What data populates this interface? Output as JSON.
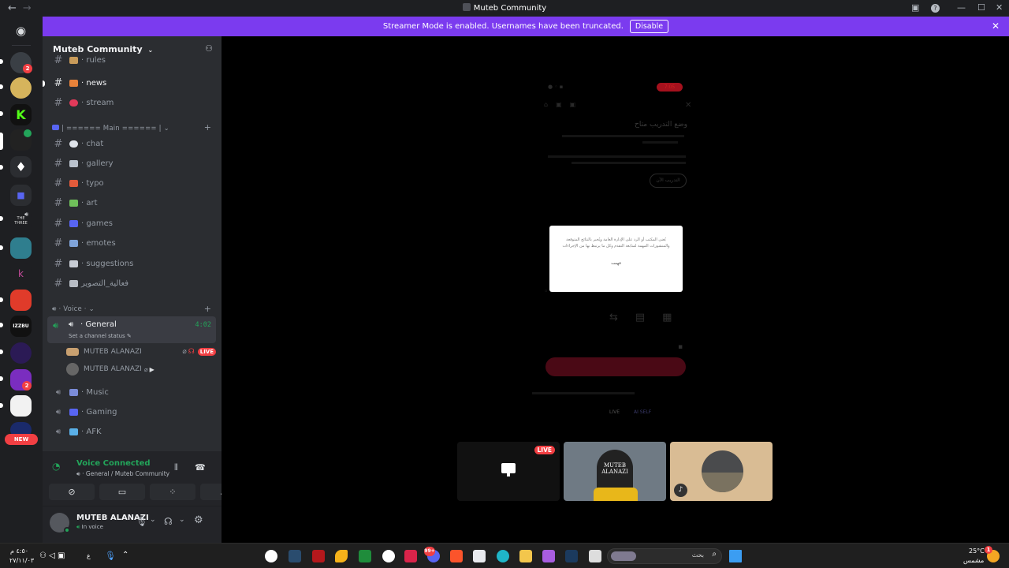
{
  "window": {
    "title": "Muteb Community",
    "back": "←",
    "forward": "→",
    "minimize": "—",
    "maximize": "☐",
    "close": "✕",
    "help": "?"
  },
  "banner": {
    "text": "Streamer Mode is enabled. Usernames have been truncated.",
    "button": "Disable"
  },
  "server_badges": {
    "first": "2",
    "second": "2",
    "new_label": "NEW",
    "vertical_label": "THE\nTHREE"
  },
  "guild": {
    "name": "Muteb Community"
  },
  "channels_top": [
    {
      "name": "rules",
      "emoji_color": "#c89b5a"
    },
    {
      "name": "news",
      "emoji_color": "#e8823a",
      "active": true
    },
    {
      "name": "stream",
      "emoji_color": "#e23a5a"
    }
  ],
  "category_main": {
    "label": "| ====== Main ====== |"
  },
  "channels_main": [
    {
      "name": "chat",
      "emoji_color": "#dfe3ea"
    },
    {
      "name": "gallery",
      "emoji_color": "#b9c1cc"
    },
    {
      "name": "typo",
      "emoji_color": "#e25b3b"
    },
    {
      "name": "art",
      "emoji_color": "#6fbf5a"
    },
    {
      "name": "games",
      "emoji_color": "#5865f2"
    },
    {
      "name": "emotes",
      "emoji_color": "#7fa3d8"
    },
    {
      "name": "suggestions",
      "emoji_color": "#c7ccd4"
    },
    {
      "name": "فعالية_التصوير",
      "emoji_color": "#b7bcc4"
    }
  ],
  "category_voice": {
    "label": "Voice"
  },
  "voice_channels": {
    "general": {
      "name": "General",
      "timer": "4:02",
      "status": "Set a channel status"
    },
    "users": [
      {
        "name": "MUTEB ALANAZI",
        "live": "LIVE"
      },
      {
        "name": "MUTEB ALANAZI"
      }
    ],
    "others": [
      {
        "name": "Music",
        "emoji_color": "#7b8cd8"
      },
      {
        "name": "Gaming",
        "emoji_color": "#5865f2"
      },
      {
        "name": "AFK",
        "emoji_color": "#5ab0e8"
      }
    ]
  },
  "voice_panel": {
    "status": "Voice Connected",
    "location": "General / Muteb Community"
  },
  "user_panel": {
    "name": "MUTEB ALANAZI",
    "status": "In voice"
  },
  "stage": {
    "phone_title": "وضع التدريب متاح",
    "phone_button": "التدريب الآن",
    "phone_pill": "7:05",
    "dialog_text": "يُعنى المكتب أو الرد على الإدارة العامة ويُخبر بالنتائج المتوقعة والمنشورات المهمة لمتابعة التقدم وكل ما يرتبط بها من الإجراءات",
    "dialog_ok": "فهمت",
    "live_badge": "LIVE",
    "phone_tabs": [
      "LIVE",
      "AI SELF"
    ],
    "tile_text_1": "MUTEB",
    "tile_text_2": "ALANAZI"
  },
  "taskbar": {
    "time": "٤:٥٠ م",
    "date": "٢٧/١١/٠٣",
    "lang": "ع",
    "search_placeholder": "بحث",
    "weather_temp": "25°C",
    "weather_label": "مشمس",
    "notif_count": "1",
    "discord_badge": "99+"
  }
}
